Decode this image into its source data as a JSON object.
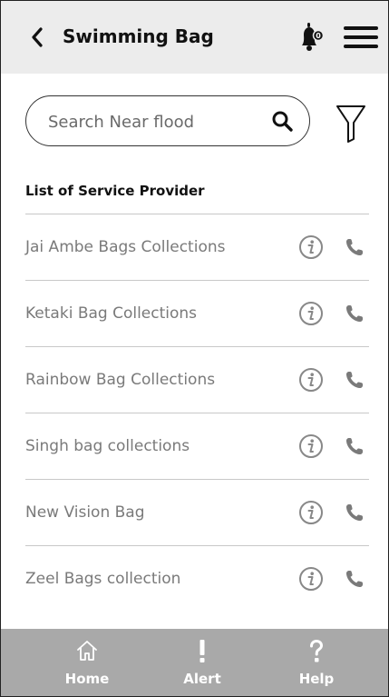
{
  "header": {
    "title": "Swimming Bag",
    "back_icon": "chevron-left-icon",
    "bell_icon": "bell-icon",
    "menu_icon": "hamburger-menu-icon",
    "background": "#ececec"
  },
  "search": {
    "placeholder": "Search Near flood",
    "value": "",
    "icon": "search-icon",
    "filter_icon": "filter-icon"
  },
  "list": {
    "title": "List of Service Provider",
    "items": [
      {
        "name": "Jai Ambe Bags Collections"
      },
      {
        "name": "Ketaki Bag Collections"
      },
      {
        "name": "Rainbow Bag Collections"
      },
      {
        "name": "Singh bag collections"
      },
      {
        "name": "New Vision Bag"
      },
      {
        "name": "Zeel Bags collection"
      }
    ],
    "info_icon": "info-icon",
    "call_icon": "phone-icon"
  },
  "bottom_nav": {
    "background": "#a9a9a9",
    "items": [
      {
        "label": "Home",
        "icon": "home-icon"
      },
      {
        "label": "Alert",
        "icon": "exclamation-icon"
      },
      {
        "label": "Help",
        "icon": "question-icon"
      }
    ]
  }
}
